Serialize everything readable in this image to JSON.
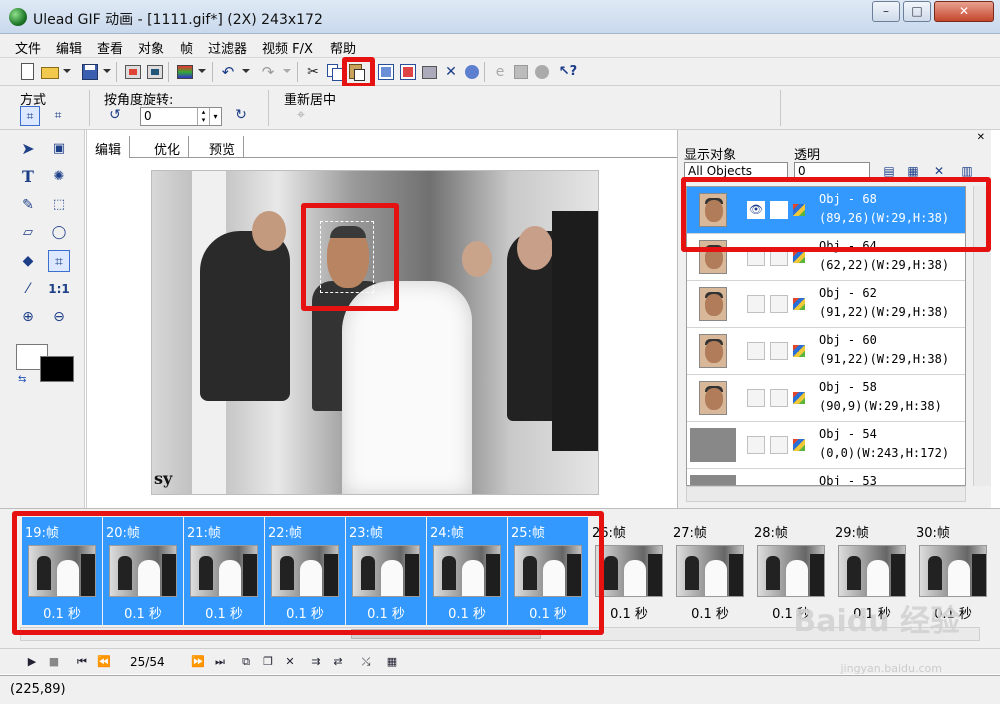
{
  "window": {
    "title": "Ulead GIF 动画 - [1111.gif*] (2X) 243x172",
    "minimize": "–",
    "maximize": "□",
    "close": "✕"
  },
  "menu": [
    "文件",
    "编辑",
    "查看",
    "对象",
    "帧",
    "过滤器",
    "视频 F/X",
    "帮助"
  ],
  "options": {
    "mode_label": "方式",
    "rotate_label": "按角度旋转:",
    "rotate_value": "0",
    "recenter_label": "重新居中"
  },
  "editor": {
    "tabs": [
      "编辑",
      "优化",
      "预览"
    ],
    "active_tab": 0,
    "canvas_watermark": "sy"
  },
  "object_panel": {
    "show_label": "显示对象",
    "show_value": "All Objects",
    "transparency_label": "透明",
    "transparency_value": "0",
    "objects": [
      {
        "name": "Obj - 68",
        "info": "(89,26)(W:29,H:38)",
        "selected": true
      },
      {
        "name": "Obj - 64",
        "info": "(62,22)(W:29,H:38)",
        "selected": false
      },
      {
        "name": "Obj - 62",
        "info": "(91,22)(W:29,H:38)",
        "selected": false
      },
      {
        "name": "Obj - 60",
        "info": "(91,22)(W:29,H:38)",
        "selected": false
      },
      {
        "name": "Obj - 58",
        "info": "(90,9)(W:29,H:38)",
        "selected": false
      },
      {
        "name": "Obj - 54",
        "info": "(0,0)(W:243,H:172)",
        "selected": false
      },
      {
        "name": "Obj - 53",
        "info": "",
        "selected": false
      }
    ]
  },
  "frames": [
    {
      "label": "19:帧",
      "delay": "0.1 秒",
      "selected": true
    },
    {
      "label": "20:帧",
      "delay": "0.1 秒",
      "selected": true
    },
    {
      "label": "21:帧",
      "delay": "0.1 秒",
      "selected": true
    },
    {
      "label": "22:帧",
      "delay": "0.1 秒",
      "selected": true
    },
    {
      "label": "23:帧",
      "delay": "0.1 秒",
      "selected": true
    },
    {
      "label": "24:帧",
      "delay": "0.1 秒",
      "selected": true
    },
    {
      "label": "25:帧",
      "delay": "0.1 秒",
      "selected": true
    },
    {
      "label": "26:帧",
      "delay": "0.1 秒",
      "selected": false
    },
    {
      "label": "27:帧",
      "delay": "0.1 秒",
      "selected": false
    },
    {
      "label": "28:帧",
      "delay": "0.1 秒",
      "selected": false
    },
    {
      "label": "29:帧",
      "delay": "0.1 秒",
      "selected": false
    },
    {
      "label": "30:帧",
      "delay": "0.1 秒",
      "selected": false
    }
  ],
  "playbar": {
    "frame_counter": "25/54"
  },
  "status": {
    "coords": "(225,89)"
  },
  "watermark": {
    "brand": "Baidu 经验",
    "url": "jingyan.baidu.com"
  },
  "colors": {
    "selection": "#3399ff",
    "highlight": "#e61111"
  }
}
